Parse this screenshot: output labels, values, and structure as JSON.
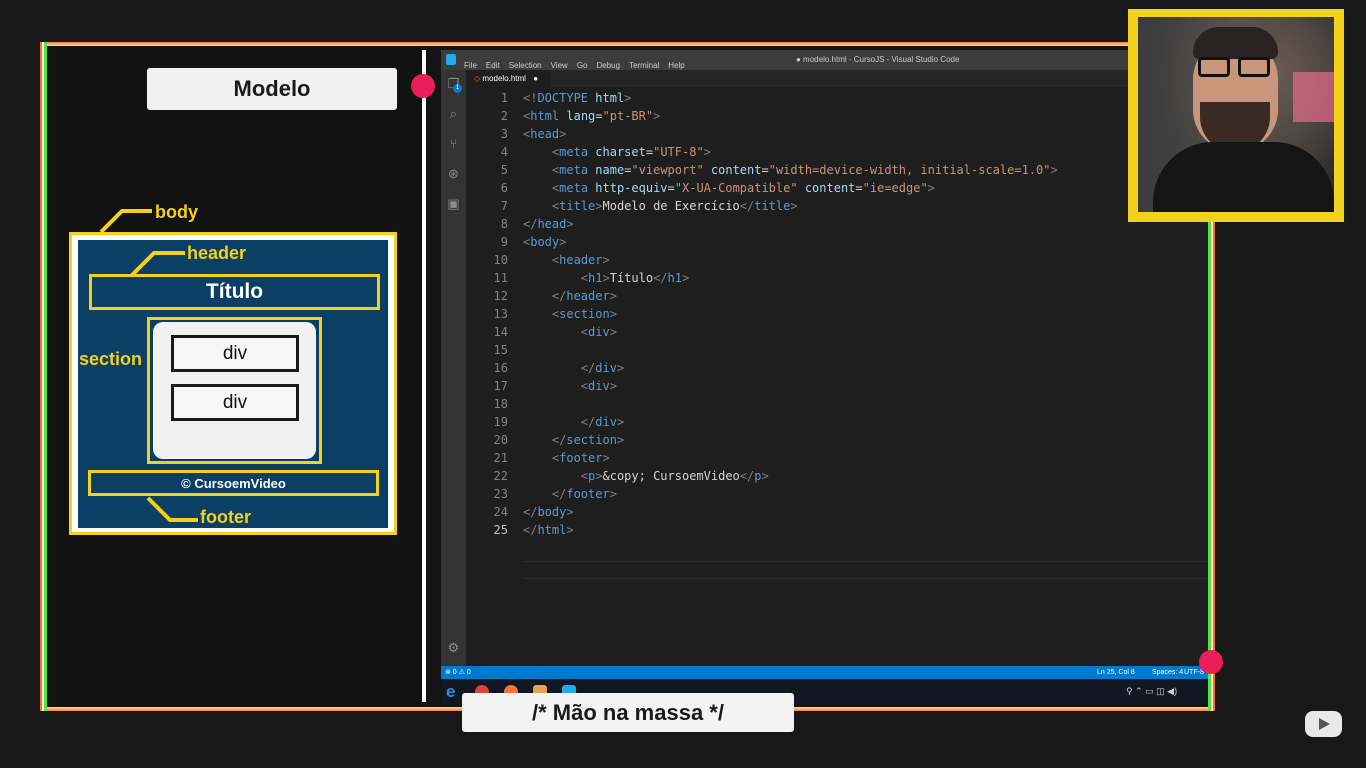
{
  "slide": {
    "modelo_title": "Modelo",
    "caption": "/* Mão na massa */"
  },
  "diagram": {
    "body_label": "body",
    "header_label": "header",
    "titulo": "Título",
    "section_label": "section",
    "div1": "div",
    "div2": "div",
    "footer_text": "© CursoemVideo",
    "footer_label": "footer"
  },
  "vscode": {
    "menu": [
      "File",
      "Edit",
      "Selection",
      "View",
      "Go",
      "Debug",
      "Terminal",
      "Help"
    ],
    "window_title": "● modelo.html - CursoJS - Visual Studio Code",
    "tab_label": "modelo.html",
    "tab_dirty": "●",
    "explorer_badge": "1",
    "status": {
      "problems": "⊗ 0 ⚠ 0",
      "position": "Ln 25, Col 8",
      "spaces": "Spaces: 4",
      "encoding": "UTF-8"
    },
    "code": [
      {
        "n": "1",
        "s": [
          [
            "br",
            "<!"
          ],
          [
            "tag",
            "DOCTYPE"
          ],
          [
            "txt",
            " "
          ],
          [
            "attr",
            "html"
          ],
          [
            "br",
            ">"
          ]
        ]
      },
      {
        "n": "2",
        "s": [
          [
            "br",
            "<"
          ],
          [
            "tag",
            "html"
          ],
          [
            "txt",
            " "
          ],
          [
            "attr",
            "lang"
          ],
          [
            "txt",
            "="
          ],
          [
            "str",
            "\"pt-BR\""
          ],
          [
            "br",
            ">"
          ]
        ]
      },
      {
        "n": "3",
        "s": [
          [
            "br",
            "<"
          ],
          [
            "tag",
            "head"
          ],
          [
            "br",
            ">"
          ]
        ]
      },
      {
        "n": "4",
        "s": [
          [
            "txt",
            "    "
          ],
          [
            "br",
            "<"
          ],
          [
            "tag",
            "meta"
          ],
          [
            "txt",
            " "
          ],
          [
            "attr",
            "charset"
          ],
          [
            "txt",
            "="
          ],
          [
            "str",
            "\"UTF-8\""
          ],
          [
            "br",
            ">"
          ]
        ]
      },
      {
        "n": "5",
        "s": [
          [
            "txt",
            "    "
          ],
          [
            "br",
            "<"
          ],
          [
            "tag",
            "meta"
          ],
          [
            "txt",
            " "
          ],
          [
            "attr",
            "name"
          ],
          [
            "txt",
            "="
          ],
          [
            "str",
            "\"viewport\""
          ],
          [
            "txt",
            " "
          ],
          [
            "attr",
            "content"
          ],
          [
            "txt",
            "="
          ],
          [
            "str",
            "\"width=device-width, initial-scale=1.0\""
          ],
          [
            "br",
            ">"
          ]
        ]
      },
      {
        "n": "6",
        "s": [
          [
            "txt",
            "    "
          ],
          [
            "br",
            "<"
          ],
          [
            "tag",
            "meta"
          ],
          [
            "txt",
            " "
          ],
          [
            "attr",
            "http-equiv"
          ],
          [
            "txt",
            "="
          ],
          [
            "str",
            "\"X-UA-Compatible\""
          ],
          [
            "txt",
            " "
          ],
          [
            "attr",
            "content"
          ],
          [
            "txt",
            "="
          ],
          [
            "str",
            "\"ie=edge\""
          ],
          [
            "br",
            ">"
          ]
        ]
      },
      {
        "n": "7",
        "s": [
          [
            "txt",
            "    "
          ],
          [
            "br",
            "<"
          ],
          [
            "tag",
            "title"
          ],
          [
            "br",
            ">"
          ],
          [
            "txt",
            "Modelo de Exercício"
          ],
          [
            "br",
            "</"
          ],
          [
            "tag",
            "title"
          ],
          [
            "br",
            ">"
          ]
        ]
      },
      {
        "n": "8",
        "s": [
          [
            "br",
            "</"
          ],
          [
            "tag",
            "head"
          ],
          [
            "br",
            ">"
          ]
        ]
      },
      {
        "n": "9",
        "s": [
          [
            "br",
            "<"
          ],
          [
            "tag",
            "body"
          ],
          [
            "br",
            ">"
          ]
        ]
      },
      {
        "n": "10",
        "s": [
          [
            "txt",
            "    "
          ],
          [
            "br",
            "<"
          ],
          [
            "tag",
            "header"
          ],
          [
            "br",
            ">"
          ]
        ]
      },
      {
        "n": "11",
        "s": [
          [
            "txt",
            "        "
          ],
          [
            "br",
            "<"
          ],
          [
            "tag",
            "h1"
          ],
          [
            "br",
            ">"
          ],
          [
            "txt",
            "Título"
          ],
          [
            "br",
            "</"
          ],
          [
            "tag",
            "h1"
          ],
          [
            "br",
            ">"
          ]
        ]
      },
      {
        "n": "12",
        "s": [
          [
            "txt",
            "    "
          ],
          [
            "br",
            "</"
          ],
          [
            "tag",
            "header"
          ],
          [
            "br",
            ">"
          ]
        ]
      },
      {
        "n": "13",
        "s": [
          [
            "txt",
            "    "
          ],
          [
            "br",
            "<"
          ],
          [
            "tag",
            "section"
          ],
          [
            "br",
            ">"
          ]
        ]
      },
      {
        "n": "14",
        "s": [
          [
            "txt",
            "        "
          ],
          [
            "br",
            "<"
          ],
          [
            "tag",
            "div"
          ],
          [
            "br",
            ">"
          ]
        ]
      },
      {
        "n": "15",
        "s": []
      },
      {
        "n": "16",
        "s": [
          [
            "txt",
            "        "
          ],
          [
            "br",
            "</"
          ],
          [
            "tag",
            "div"
          ],
          [
            "br",
            ">"
          ]
        ]
      },
      {
        "n": "17",
        "s": [
          [
            "txt",
            "        "
          ],
          [
            "br",
            "<"
          ],
          [
            "tag",
            "div"
          ],
          [
            "br",
            ">"
          ]
        ]
      },
      {
        "n": "18",
        "s": []
      },
      {
        "n": "19",
        "s": [
          [
            "txt",
            "        "
          ],
          [
            "br",
            "</"
          ],
          [
            "tag",
            "div"
          ],
          [
            "br",
            ">"
          ]
        ]
      },
      {
        "n": "20",
        "s": [
          [
            "txt",
            "    "
          ],
          [
            "br",
            "</"
          ],
          [
            "tag",
            "section"
          ],
          [
            "br",
            ">"
          ]
        ]
      },
      {
        "n": "21",
        "s": [
          [
            "txt",
            "    "
          ],
          [
            "br",
            "<"
          ],
          [
            "tag",
            "footer"
          ],
          [
            "br",
            ">"
          ]
        ]
      },
      {
        "n": "22",
        "s": [
          [
            "txt",
            "        "
          ],
          [
            "br",
            "<"
          ],
          [
            "tag",
            "p"
          ],
          [
            "br",
            ">"
          ],
          [
            "txt",
            "&copy; CursoemVideo"
          ],
          [
            "br",
            "</"
          ],
          [
            "tag",
            "p"
          ],
          [
            "br",
            ">"
          ]
        ]
      },
      {
        "n": "23",
        "s": [
          [
            "txt",
            "    "
          ],
          [
            "br",
            "</"
          ],
          [
            "tag",
            "footer"
          ],
          [
            "br",
            ">"
          ]
        ]
      },
      {
        "n": "24",
        "s": [
          [
            "br",
            "</"
          ],
          [
            "tag",
            "body"
          ],
          [
            "br",
            ">"
          ]
        ]
      },
      {
        "n": "25",
        "s": [
          [
            "br",
            "</"
          ],
          [
            "tag",
            "html"
          ],
          [
            "br",
            ">"
          ]
        ]
      }
    ]
  },
  "colors": {
    "accent_yellow": "#f4d11c",
    "diagram_blue": "#0b3f63",
    "record_red": "#e91e5a",
    "vscode_status": "#007acc"
  }
}
